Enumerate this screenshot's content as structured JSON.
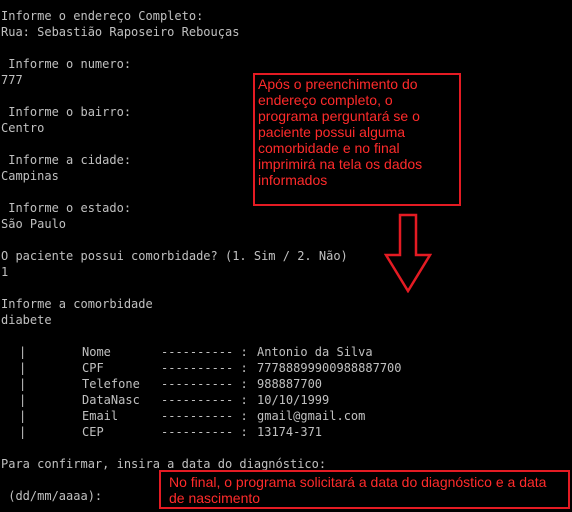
{
  "console": {
    "lines": [
      "Informe o endereço Completo:",
      "Rua: Sebastião Raposeiro Rebouças",
      " Informe o numero:",
      "777",
      " Informe o bairro:",
      "Centro",
      " Informe a cidade:",
      "Campinas",
      " Informe o estado:",
      "São Paulo",
      "O paciente possui comorbidade? (1. Sim / 2. Não)",
      "1",
      "Informe a comorbidade",
      "diabete",
      "Para confirmar, insira a data do diagnóstico:",
      " (dd/mm/aaaa):"
    ],
    "summary": {
      "bar": "|",
      "dashes": "---------- :",
      "rows": [
        {
          "field": "Nome",
          "value": "Antonio da Silva"
        },
        {
          "field": "CPF",
          "value": "77788899900988887700"
        },
        {
          "field": "Telefone",
          "value": "988887700"
        },
        {
          "field": "DataNasc",
          "value": "10/10/1999"
        },
        {
          "field": "Email",
          "value": "gmail@gmail.com"
        },
        {
          "field": "CEP",
          "value": "13174-371"
        }
      ]
    }
  },
  "annotations": {
    "top_note": "Após o preenchimento do endereço completo, o programa perguntará se o paciente possui alguma comorbidade e no final imprimirá na tela os dados informados",
    "bottom_note": "No final, o programa solicitará a data do diagnóstico e a data de nascimento",
    "color": "#e41b23"
  }
}
